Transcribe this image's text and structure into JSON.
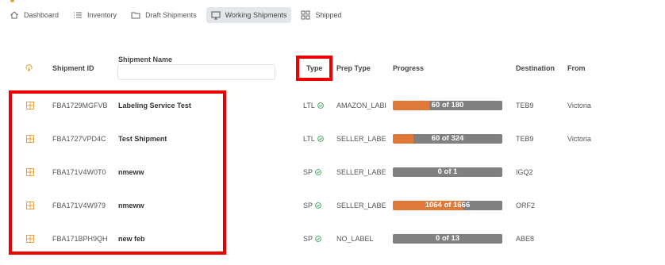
{
  "nav": {
    "items": [
      {
        "label": "Dashboard",
        "icon": "home-icon"
      },
      {
        "label": "Inventory",
        "icon": "list-icon"
      },
      {
        "label": "Draft Shipments",
        "icon": "folder-icon"
      },
      {
        "label": "Working Shipments",
        "icon": "monitor-icon",
        "active": true
      },
      {
        "label": "Shipped",
        "icon": "grid-icon"
      }
    ]
  },
  "table": {
    "headers": {
      "sync_icon": "sync-icon",
      "shipment_id": "Shipment ID",
      "shipment_name": "Shipment Name",
      "type": "Type",
      "prep_type": "Prep Type",
      "progress": "Progress",
      "destination": "Destination",
      "from": "From"
    },
    "name_filter_value": "",
    "rows": [
      {
        "id": "FBA1729MGFVB",
        "name": "Labeling Service Test",
        "type": "LTL",
        "prep": "AMAZON_LABE",
        "progress_label": "60 of 180",
        "progress_fraction": 0.333,
        "destination": "TEB9",
        "from": "Victoria"
      },
      {
        "id": "FBA1727VPD4C",
        "name": "Test Shipment",
        "type": "LTL",
        "prep": "SELLER_LABEL",
        "progress_label": "60 of 324",
        "progress_fraction": 0.185,
        "destination": "TEB9",
        "from": "Victoria"
      },
      {
        "id": "FBA171V4W0T0",
        "name": "nmeww",
        "type": "SP",
        "prep": "SELLER_LABEL",
        "progress_label": "0 of 1",
        "progress_fraction": 0,
        "destination": "IGQ2",
        "from": ""
      },
      {
        "id": "FBA171V4W979",
        "name": "nmeww",
        "type": "SP",
        "prep": "SELLER_LABEL",
        "progress_label": "1064 of 1666",
        "progress_fraction": 0.639,
        "destination": "ORF2",
        "from": ""
      },
      {
        "id": "FBA171BPH9QH",
        "name": "new feb",
        "type": "SP",
        "prep": "NO_LABEL",
        "progress_label": "0 of 13",
        "progress_fraction": 0,
        "destination": "ABE8",
        "from": ""
      }
    ]
  },
  "colors": {
    "accent": "#e8a23a",
    "progress_fill": "#e07a3a",
    "progress_track": "#808080",
    "check_green": "#3aa655",
    "highlight": "#ee0000"
  }
}
